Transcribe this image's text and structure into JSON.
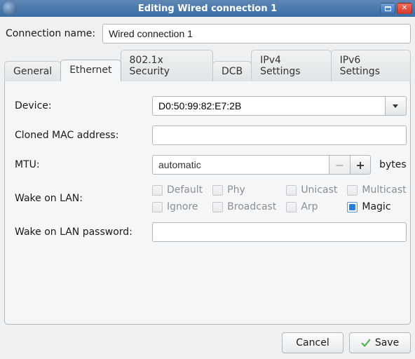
{
  "window": {
    "title": "Editing Wired connection 1"
  },
  "connection": {
    "name_label": "Connection name:",
    "name_value": "Wired connection 1"
  },
  "tabs": [
    {
      "id": "general",
      "label": "General"
    },
    {
      "id": "ethernet",
      "label": "Ethernet"
    },
    {
      "id": "8021x",
      "label": "802.1x Security"
    },
    {
      "id": "dcb",
      "label": "DCB"
    },
    {
      "id": "ipv4",
      "label": "IPv4 Settings"
    },
    {
      "id": "ipv6",
      "label": "IPv6 Settings"
    }
  ],
  "active_tab": "ethernet",
  "form": {
    "device_label": "Device:",
    "device_value": "D0:50:99:82:E7:2B",
    "cloned_mac_label": "Cloned MAC address:",
    "cloned_mac_value": "",
    "mtu_label": "MTU:",
    "mtu_value": "automatic",
    "mtu_unit": "bytes",
    "wol_label": "Wake on LAN:",
    "wol_options": [
      {
        "id": "default",
        "label": "Default",
        "checked": false,
        "enabled": false
      },
      {
        "id": "phy",
        "label": "Phy",
        "checked": false,
        "enabled": false
      },
      {
        "id": "unicast",
        "label": "Unicast",
        "checked": false,
        "enabled": false
      },
      {
        "id": "multicast",
        "label": "Multicast",
        "checked": false,
        "enabled": false
      },
      {
        "id": "ignore",
        "label": "Ignore",
        "checked": false,
        "enabled": false
      },
      {
        "id": "broadcast",
        "label": "Broadcast",
        "checked": false,
        "enabled": false
      },
      {
        "id": "arp",
        "label": "Arp",
        "checked": false,
        "enabled": false
      },
      {
        "id": "magic",
        "label": "Magic",
        "checked": true,
        "enabled": true
      }
    ],
    "wol_password_label": "Wake on LAN password:",
    "wol_password_value": ""
  },
  "buttons": {
    "cancel": "Cancel",
    "save": "Save"
  }
}
